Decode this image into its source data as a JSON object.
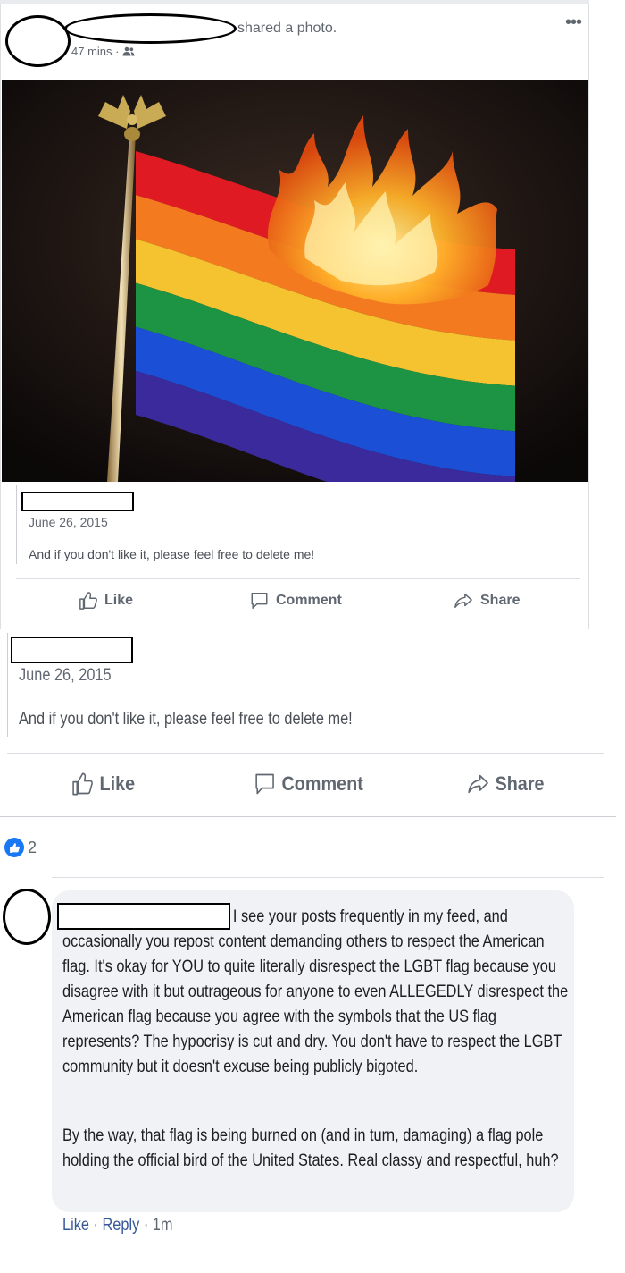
{
  "post": {
    "shared_text": "shared a photo.",
    "timestamp": "47 mins",
    "timestamp_sep": "·"
  },
  "shared_post": {
    "date": "June 26, 2015",
    "text": "And if you don't like it, please feel free to delete me!"
  },
  "actions": {
    "like": "Like",
    "comment": "Comment",
    "share": "Share"
  },
  "reactions": {
    "count": "2"
  },
  "comment": {
    "paragraph1": "I see your posts frequently in my feed, and occasionally you repost content demanding others to respect the American flag. It's okay for YOU to quite literally disrespect the LGBT flag because you disagree with it but outrageous for anyone to even ALLEGEDLY disrespect the American flag because you agree with the symbols that the US flag represents? The hypocrisy is cut and dry. You don't have to respect the LGBT community but it doesn't excuse being publicly bigoted.",
    "paragraph2": "By the way, that flag is being burned on (and in turn, damaging) a flag pole holding the official bird of the United States. Real classy and respectful, huh?",
    "like": "Like",
    "reply": "Reply",
    "time": "1m"
  },
  "colors": {
    "flag": [
      "#e01a22",
      "#f47a20",
      "#f5c330",
      "#1d9444",
      "#1a4fd6",
      "#3b2a9c"
    ],
    "link": "#385898",
    "accent": "#1877f2"
  }
}
